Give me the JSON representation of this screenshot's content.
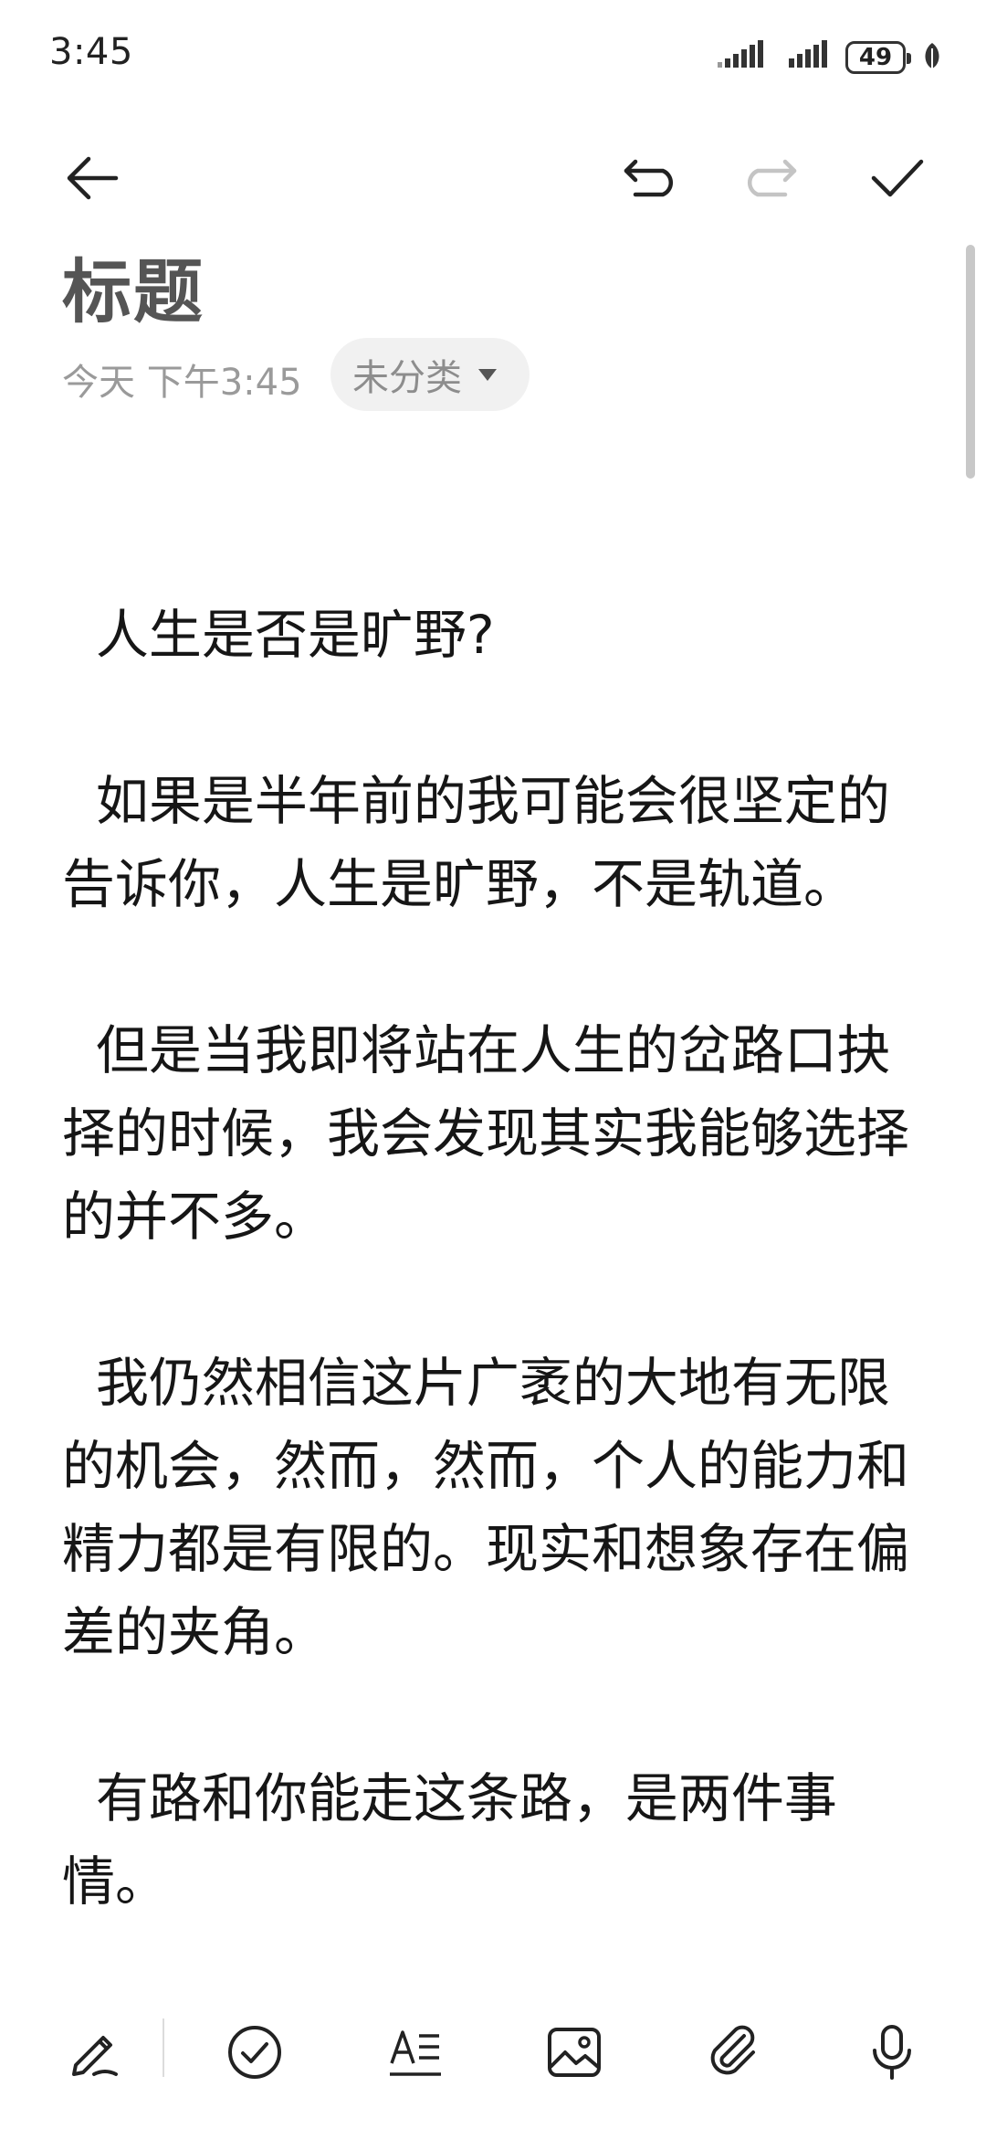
{
  "status_bar": {
    "time": "3:45",
    "battery": "49"
  },
  "toolbar": {
    "back_icon": "arrow-left-icon",
    "undo_icon": "undo-icon",
    "redo_icon": "redo-icon",
    "confirm_icon": "check-icon"
  },
  "note": {
    "title": "标题",
    "date": "今天 下午3:45",
    "category": "未分类",
    "paragraphs": [
      "  人生是否是旷野?",
      "  如果是半年前的我可能会很坚定的告诉你，人生是旷野，不是轨道。",
      "  但是当我即将站在人生的岔路口抉择的时候，我会发现其实我能够选择的并不多。",
      "  我仍然相信这片广袤的大地有无限的机会，然而，然而，个人的能力和精力都是有限的。现实和想象存在偏差的夹角。",
      "  有路和你能走这条路，是两件事情。"
    ]
  },
  "bottom_toolbar": {
    "items": [
      "pen-icon",
      "checkbox-icon",
      "text-format-icon",
      "image-icon",
      "attachment-icon",
      "microphone-icon"
    ]
  },
  "colors": {
    "text": "#161616",
    "title": "#555555",
    "meta": "#9a9a9a",
    "chip_bg": "#f1f1f1"
  }
}
